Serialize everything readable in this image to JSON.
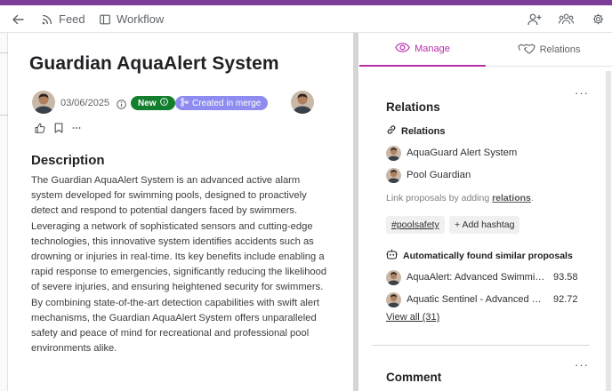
{
  "colors": {
    "accent_bar": "#7b3c9a",
    "tab_active": "#b52faa",
    "badge_new": "#137e2d",
    "badge_merge": "#8e8cf0"
  },
  "toolbar": {
    "back_icon": "arrow-left-icon",
    "feed_label": "Feed",
    "feed_icon": "rss-icon",
    "workflow_label": "Workflow",
    "workflow_icon": "columns-icon",
    "right_icons": [
      "add-user-icon",
      "people-icon",
      "gear-icon"
    ]
  },
  "proposal": {
    "title": "Guardian AquaAlert System",
    "date": "03/06/2025",
    "status_badge": "New",
    "merge_badge": "Created in merge",
    "description_heading": "Description",
    "description": "The Guardian AquaAlert System is an advanced active alarm system developed for swimming pools, designed to proactively detect and respond to potential dangers faced by swimmers. Leveraging a network of sophisticated sensors and cutting-edge technologies, this innovative system identifies accidents such as drowning or injuries in real-time. Its key benefits include enabling a rapid response to emergencies, significantly reducing the likelihood of severe injuries, and ensuring heightened security for swimmers. By combining state-of-the-art detection capabilities with swift alert mechanisms, the Guardian AquaAlert System offers unparalleled safety and peace of mind for recreational and professional pool environments alike."
  },
  "tabs": {
    "manage": "Manage",
    "relations": "Relations"
  },
  "relations_panel": {
    "heading": "Relations",
    "subheading": "Relations",
    "items": [
      {
        "label": "AquaGuard Alert System"
      },
      {
        "label": "Pool Guardian"
      }
    ],
    "hint_prefix": "Link proposals by adding ",
    "hint_link": "relations",
    "hint_suffix": ".",
    "hashtag": "#poolsafety",
    "add_hashtag": "+ Add hashtag",
    "similar_heading": "Automatically found similar proposals",
    "similar": [
      {
        "name": "AquaAlert: Advanced Swimming Pool Safety",
        "score": "93.58"
      },
      {
        "name": "Aquatic Sentinel - Advanced Pool Safety",
        "score": "92.72"
      }
    ],
    "view_all": "View all (31)"
  },
  "comment_heading": "Comment"
}
